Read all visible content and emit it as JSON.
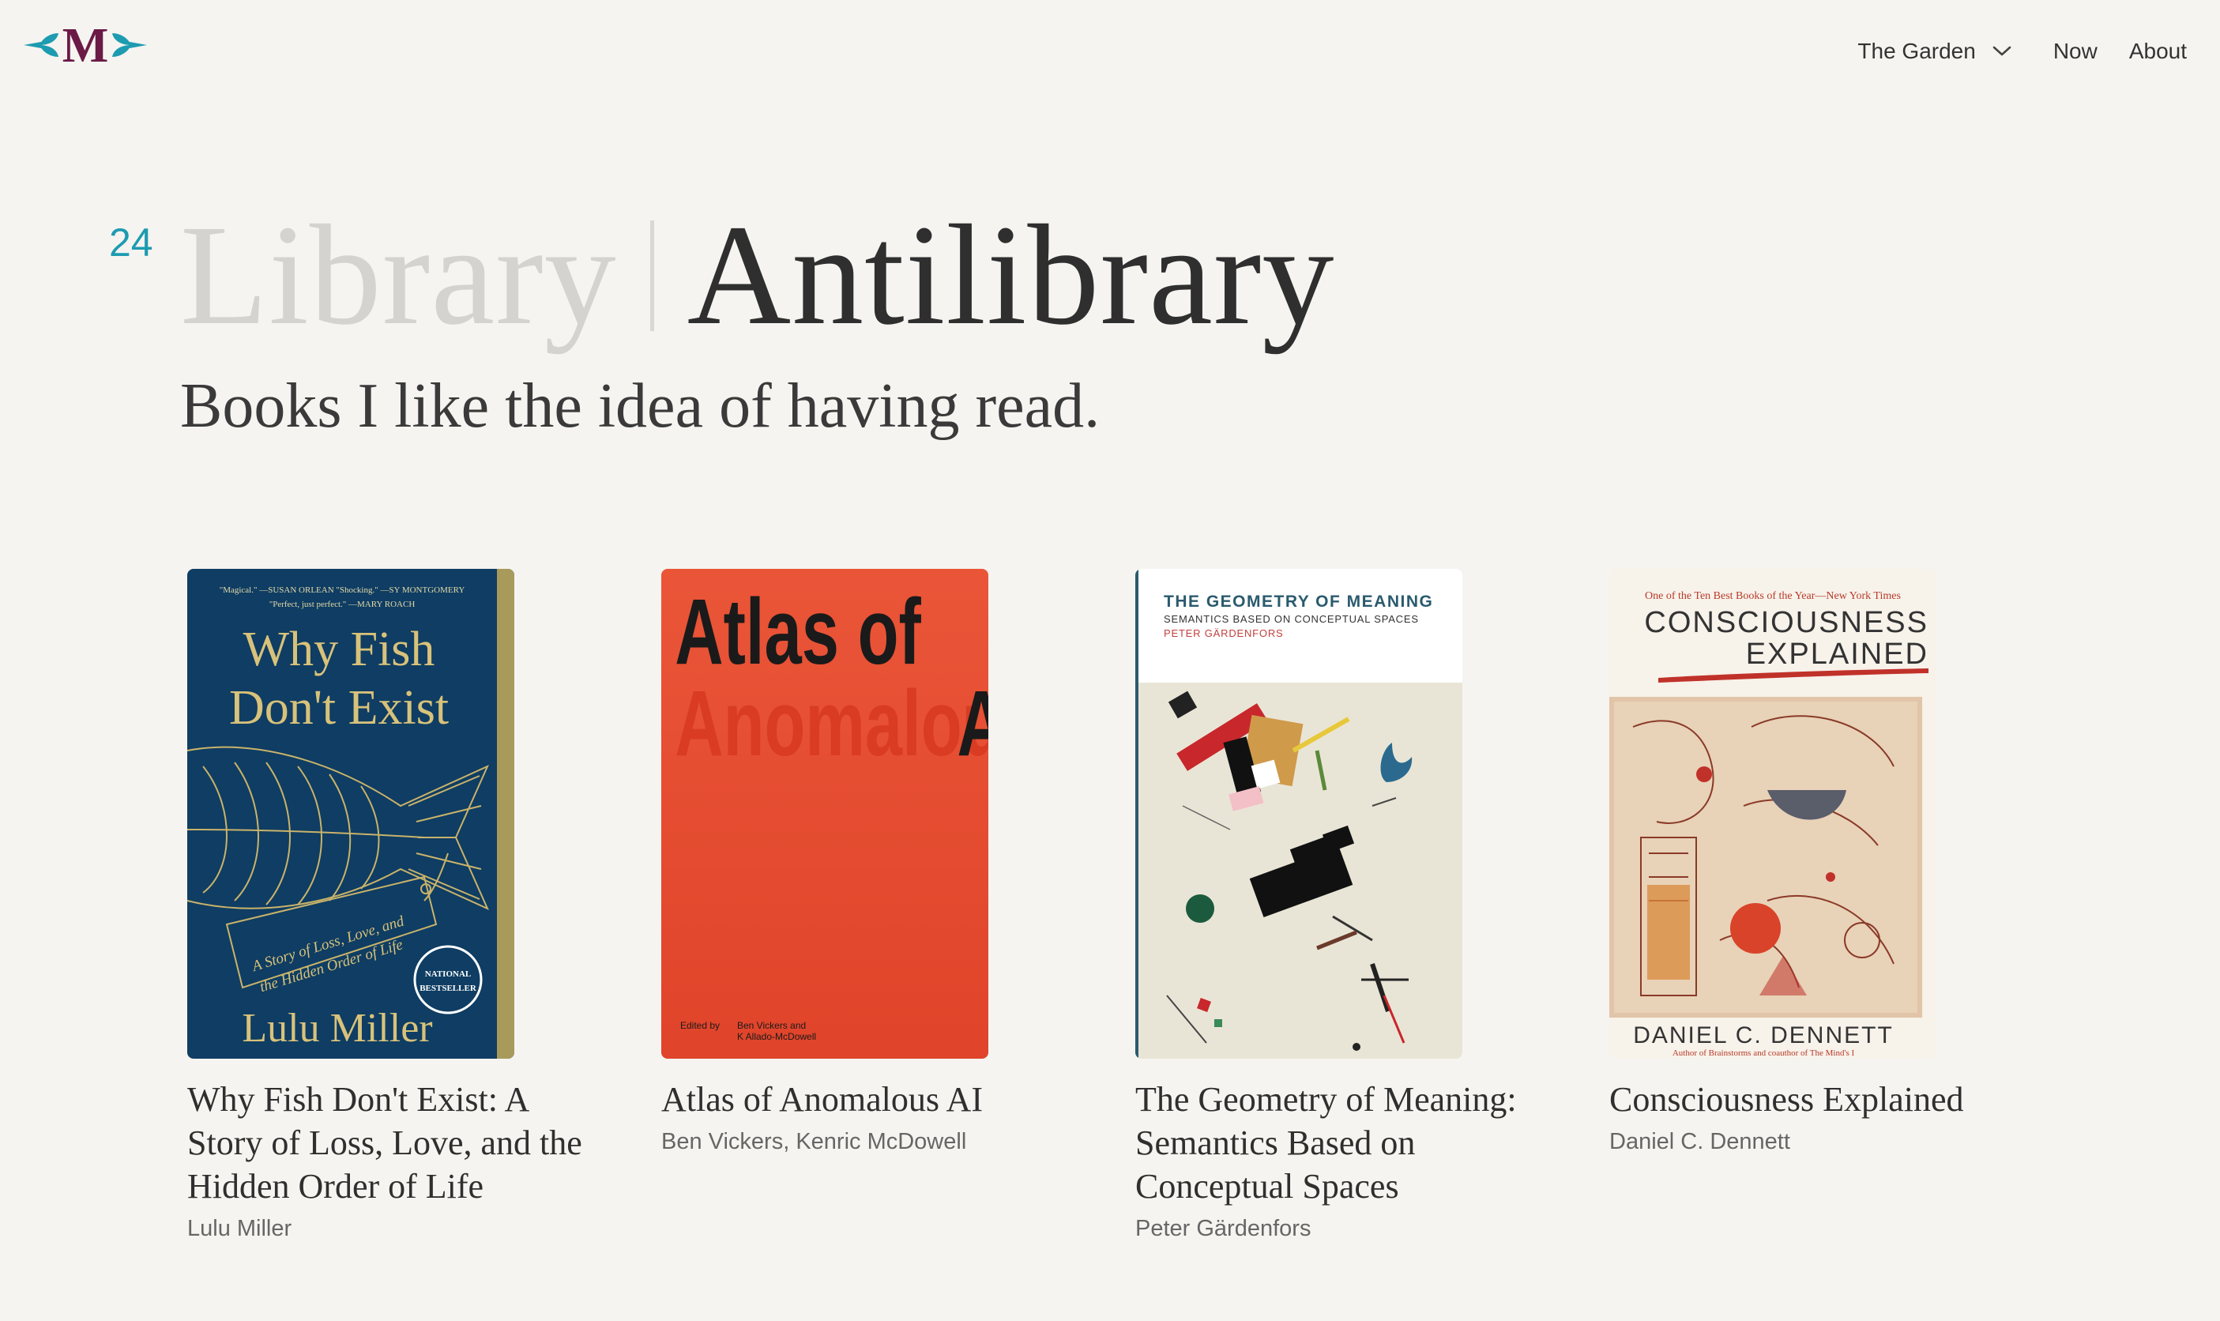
{
  "header": {
    "logo_letter": "M",
    "nav": {
      "garden_label": "The Garden",
      "now_label": "Now",
      "about_label": "About"
    }
  },
  "page": {
    "count": "24",
    "library_label": "Library",
    "antilibrary_label": "Antilibrary",
    "subtitle": "Books I like the idea of having read."
  },
  "books": [
    {
      "title": "Why Fish Don't Exist: A Story of Loss, Love, and the Hidden Order of Life",
      "author": "Lulu Miller",
      "cover": {
        "color": "#0f3d63",
        "blurb_line1": "\"Magical.\" —SUSAN ORLEAN  \"Shocking.\" —SY MONTGOMERY",
        "blurb_line2": "\"Perfect, just perfect.\" —MARY ROACH",
        "title_line1": "Why Fish",
        "title_line2": "Don't Exist",
        "tag_line1": "A Story of Loss, Love, and",
        "tag_line2": "the Hidden Order of Life",
        "badge_line1": "NATIONAL",
        "badge_line2": "BESTSELLER",
        "author": "Lulu Miller"
      }
    },
    {
      "title": "Atlas of Anomalous AI",
      "author": "Ben Vickers, Kenric McDowell",
      "cover": {
        "color": "#e64a2e",
        "title_line1": "Atlas of",
        "title_word_ghost": "Anomalous",
        "title_word_ai": "AI",
        "edited_label": "Edited by",
        "editors_line1": "Ben Vickers and",
        "editors_line2": "K Allado-McDowell"
      }
    },
    {
      "title": "The Geometry of Meaning: Semantics Based on Conceptual Spaces",
      "author": "Peter Gärdenfors",
      "cover": {
        "title": "THE GEOMETRY OF MEANING",
        "subtitle": "SEMANTICS BASED ON CONCEPTUAL SPACES",
        "author": "PETER GÄRDENFORS"
      }
    },
    {
      "title": "Consciousness Explained",
      "author": "Daniel C. Dennett",
      "cover": {
        "tagline": "One of the Ten Best Books of the Year—New York Times",
        "title_line1": "CONSCIOUSNESS",
        "title_line2": "EXPLAINED",
        "author": "DANIEL C. DENNETT",
        "footer": "Author of Brainstorms and coauthor of The Mind's I"
      }
    }
  ]
}
